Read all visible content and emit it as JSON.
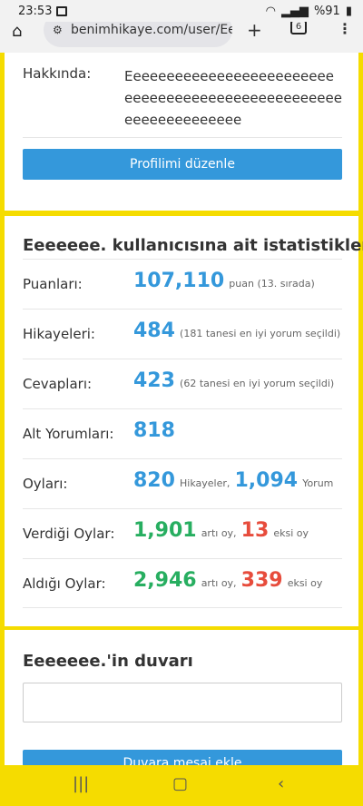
{
  "status": {
    "time": "23:53",
    "battery": "%91"
  },
  "browser": {
    "url": "benimhikaye.com/user/Eeee",
    "tab_count": "6"
  },
  "profile": {
    "about_label": "Hakkında:",
    "about_text": "Eeeeeeeeeeeeeeeeeeeeeeeeeeeeeeeeeeeeeeeeeeeeeeeeeeeeeeeeeeeeeeeee",
    "edit_button": "Profilimi düzenle"
  },
  "stats": {
    "title": "Eeeeeee. kullanıcısına ait istatistikler",
    "points": {
      "label": "Puanları:",
      "value": "107,110",
      "note": "puan (13. sırada)"
    },
    "stories": {
      "label": "Hikayeleri:",
      "value": "484",
      "note": "(181 tanesi en iyi yorum seçildi)"
    },
    "answers": {
      "label": "Cevapları:",
      "value": "423",
      "note": "(62 tanesi en iyi yorum seçildi)"
    },
    "subcomments": {
      "label": "Alt Yorumları:",
      "value": "818"
    },
    "votes": {
      "label": "Oyları:",
      "stories_value": "820",
      "stories_note": "Hikayeler,",
      "comments_value": "1,094",
      "comments_note": "Yorum"
    },
    "given": {
      "label": "Verdiği Oylar:",
      "plus_value": "1,901",
      "plus_note": "artı oy,",
      "minus_value": "13",
      "minus_note": "eksi oy"
    },
    "received": {
      "label": "Aldığı Oylar:",
      "plus_value": "2,946",
      "plus_note": "artı oy,",
      "minus_value": "339",
      "minus_note": "eksi oy"
    }
  },
  "wall": {
    "title": "Eeeeeee.'in duvarı",
    "button": "Duvara mesaj ekle"
  },
  "colors": {
    "accent": "#3498db",
    "positive": "#27ae60",
    "negative": "#e74c3c",
    "background": "#f5dc00"
  }
}
